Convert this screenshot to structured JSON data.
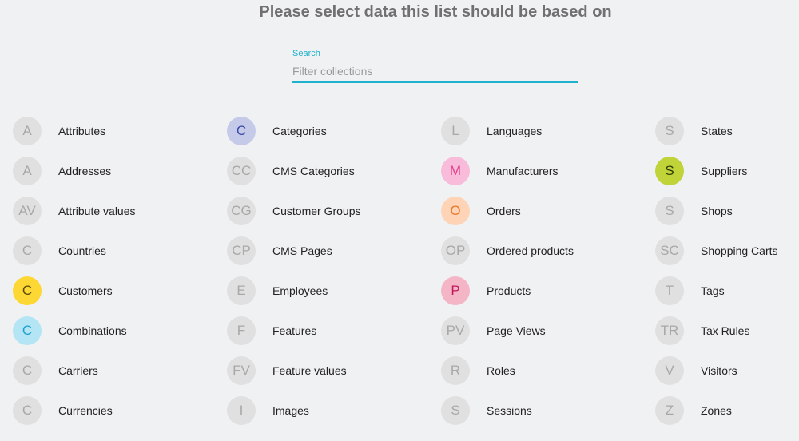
{
  "title": "Please select data this list should be based on",
  "search": {
    "label": "Search",
    "placeholder": "Filter collections",
    "value": ""
  },
  "columns": [
    [
      {
        "initials": "A",
        "label": "Attributes"
      },
      {
        "initials": "A",
        "label": "Addresses"
      },
      {
        "initials": "AV",
        "label": "Attribute values"
      },
      {
        "initials": "C",
        "label": "Countries"
      },
      {
        "initials": "C",
        "label": "Customers",
        "bg": "#fdd835",
        "fg": "#5a4a00"
      },
      {
        "initials": "C",
        "label": "Combinations",
        "bg": "#b3e5f5",
        "fg": "#1ea0d0"
      },
      {
        "initials": "C",
        "label": "Carriers"
      },
      {
        "initials": "C",
        "label": "Currencies"
      }
    ],
    [
      {
        "initials": "C",
        "label": "Categories",
        "bg": "#c5cae9",
        "fg": "#3949ab"
      },
      {
        "initials": "CC",
        "label": "CMS Categories"
      },
      {
        "initials": "CG",
        "label": "Customer Groups"
      },
      {
        "initials": "CP",
        "label": "CMS Pages"
      },
      {
        "initials": "E",
        "label": "Employees"
      },
      {
        "initials": "F",
        "label": "Features"
      },
      {
        "initials": "FV",
        "label": "Feature values"
      },
      {
        "initials": "I",
        "label": "Images"
      }
    ],
    [
      {
        "initials": "L",
        "label": "Languages"
      },
      {
        "initials": "M",
        "label": "Manufacturers",
        "bg": "#f8bbd9",
        "fg": "#e0408a"
      },
      {
        "initials": "O",
        "label": "Orders",
        "bg": "#ffd3b6",
        "fg": "#e8782a"
      },
      {
        "initials": "OP",
        "label": "Ordered products"
      },
      {
        "initials": "P",
        "label": "Products",
        "bg": "#f4b6c6",
        "fg": "#c2185b"
      },
      {
        "initials": "PV",
        "label": "Page Views"
      },
      {
        "initials": "R",
        "label": "Roles"
      },
      {
        "initials": "S",
        "label": "Sessions"
      }
    ],
    [
      {
        "initials": "S",
        "label": "States"
      },
      {
        "initials": "S",
        "label": "Suppliers",
        "bg": "#c0d43a",
        "fg": "#2e3a00"
      },
      {
        "initials": "S",
        "label": "Shops"
      },
      {
        "initials": "SC",
        "label": "Shopping Carts"
      },
      {
        "initials": "T",
        "label": "Tags"
      },
      {
        "initials": "TR",
        "label": "Tax Rules"
      },
      {
        "initials": "V",
        "label": "Visitors"
      },
      {
        "initials": "Z",
        "label": "Zones"
      }
    ]
  ]
}
